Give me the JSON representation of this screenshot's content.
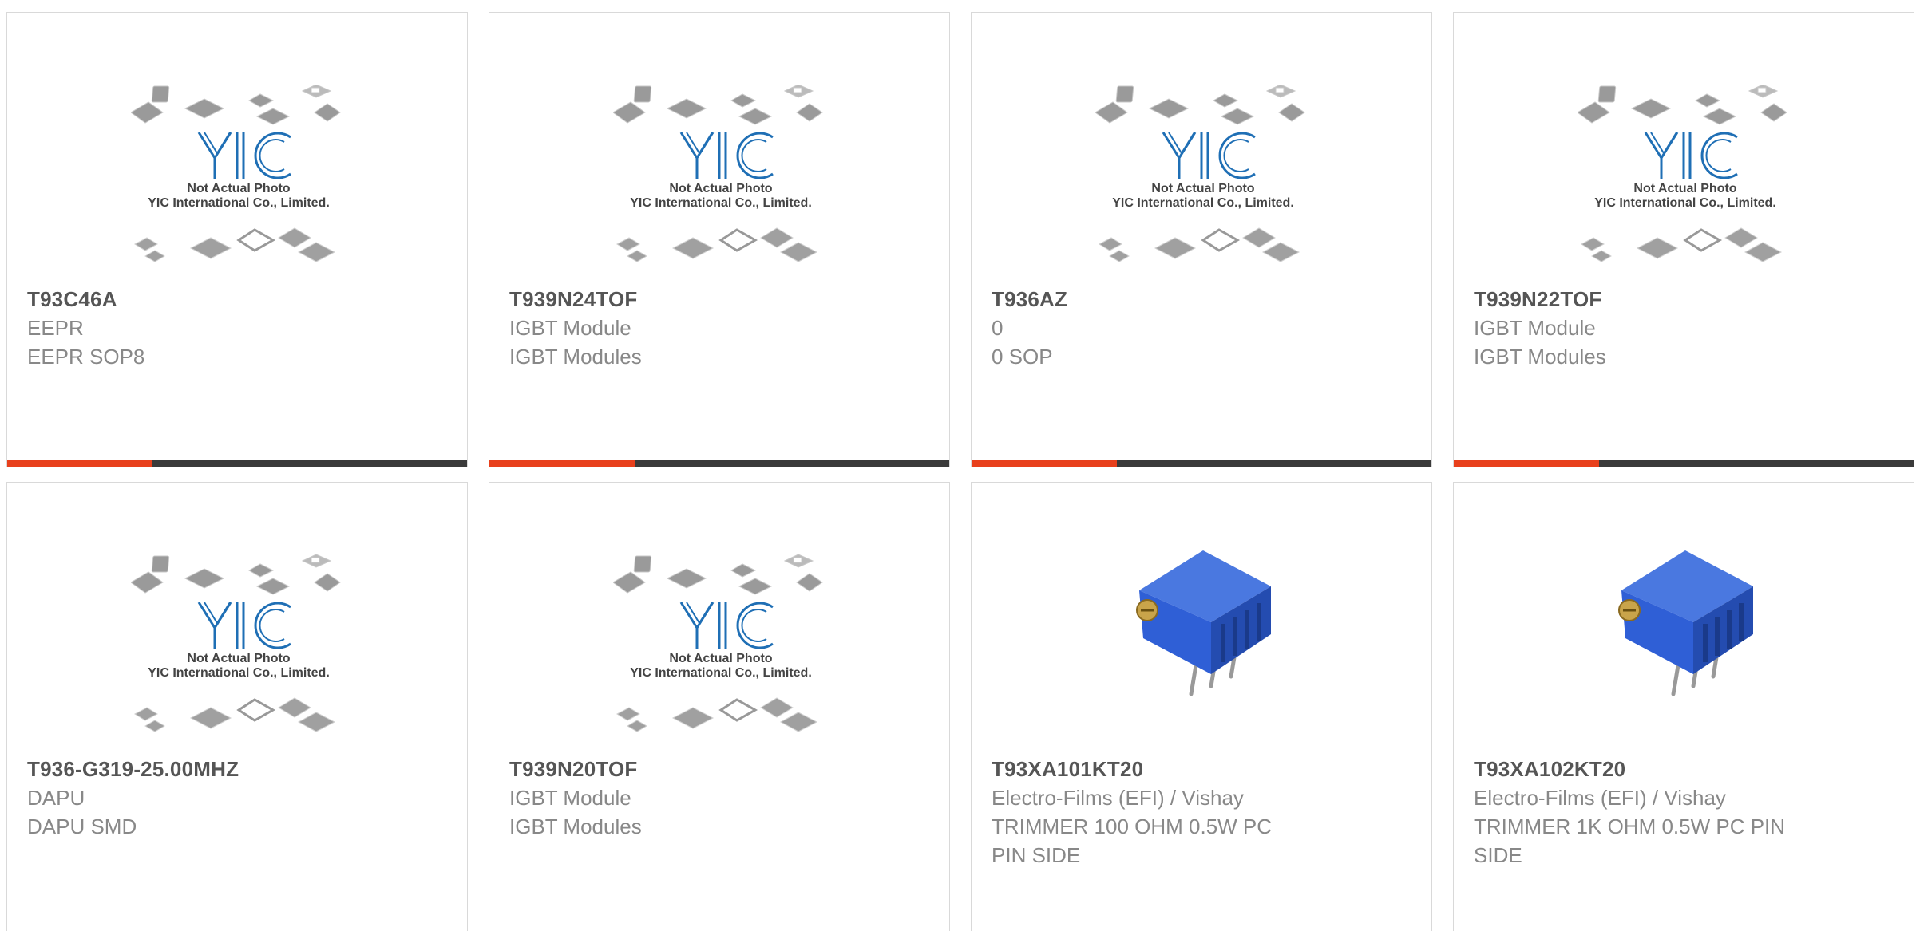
{
  "placeholder_image": {
    "logo_text": "YIC",
    "caption_line1": "Not Actual Photo",
    "caption_line2": "YIC International Co., Limited."
  },
  "colors": {
    "accent": "#e8401c",
    "bar": "#3a3a3a",
    "part_text": "#555555",
    "desc_text": "#888888",
    "logo_blue": "#1f6fb5",
    "trimmer_blue": "#2f5fd6"
  },
  "products": [
    {
      "part": "T93C46A",
      "manufacturer": "EEPR",
      "description": "EEPR SOP8",
      "image": "placeholder-image"
    },
    {
      "part": "T939N24TOF",
      "manufacturer": "IGBT Module",
      "description": "IGBT Modules",
      "image": "placeholder-image"
    },
    {
      "part": "T936AZ",
      "manufacturer": "0",
      "description": "0 SOP",
      "image": "placeholder-image"
    },
    {
      "part": "T939N22TOF",
      "manufacturer": "IGBT Module",
      "description": "IGBT Modules",
      "image": "placeholder-image"
    },
    {
      "part": "T936-G319-25.00MHZ",
      "manufacturer": "DAPU",
      "description": "DAPU SMD",
      "image": "placeholder-image"
    },
    {
      "part": "T939N20TOF",
      "manufacturer": "IGBT Module",
      "description": "IGBT Modules",
      "image": "placeholder-image"
    },
    {
      "part": "T93XA101KT20",
      "manufacturer": "Electro-Films (EFI) / Vishay",
      "description": "TRIMMER 100 OHM 0.5W PC",
      "description2": "PIN SIDE",
      "image": "trimmer-potentiometer-photo"
    },
    {
      "part": "T93XA102KT20",
      "manufacturer": "Electro-Films (EFI) / Vishay",
      "description": "TRIMMER 1K OHM 0.5W PC PIN",
      "description2": "SIDE",
      "image": "trimmer-potentiometer-photo"
    }
  ]
}
